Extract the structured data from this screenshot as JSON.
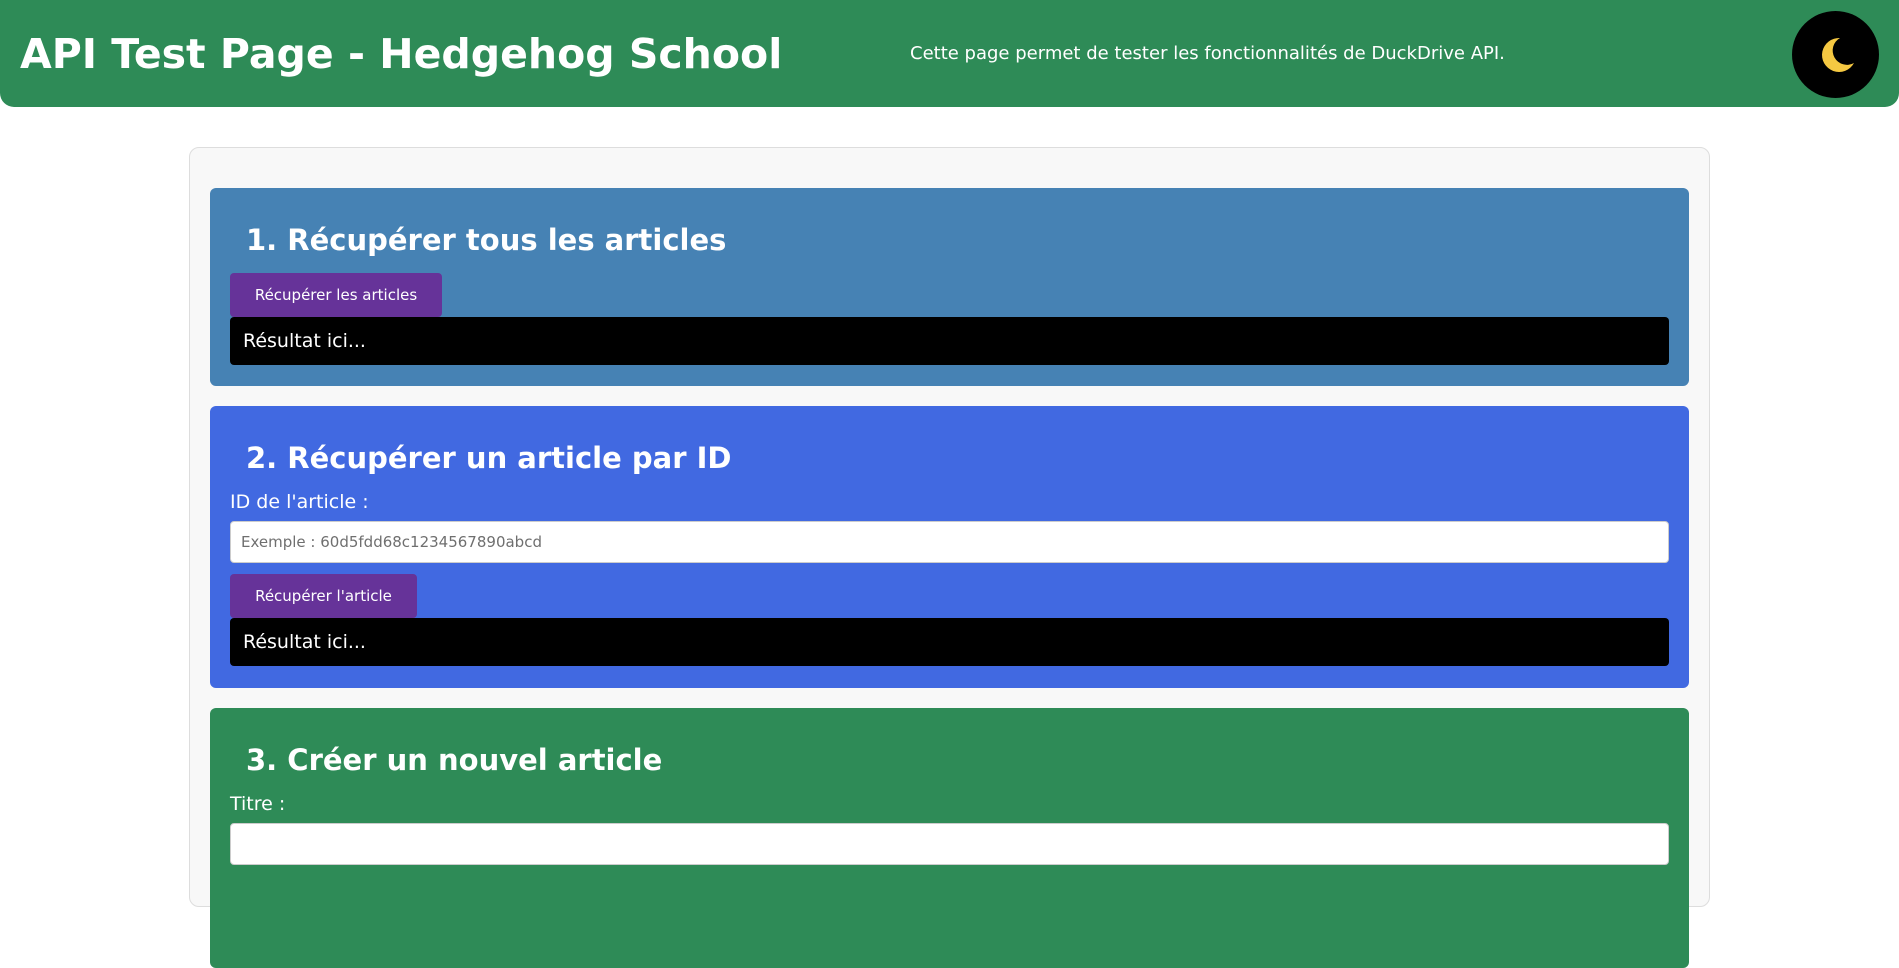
{
  "header": {
    "title": "API Test Page - Hedgehog School",
    "subtitle": "Cette page permet de tester les fonctionnalités de DuckDrive API.",
    "theme_toggle_icon": "moon-icon",
    "background_color": "#2e8b57"
  },
  "sections": [
    {
      "title": "1. Récupérer tous les articles",
      "button_label": "Récupérer les articles",
      "result_text": "Résultat ici...",
      "background_color": "#4682b4"
    },
    {
      "title": "2. Récupérer un article par ID",
      "field_label": "ID de l'article :",
      "input_placeholder": "Exemple : 60d5fdd68c1234567890abcd",
      "input_value": "",
      "button_label": "Récupérer l'article",
      "result_text": "Résultat ici...",
      "background_color": "#4169e1"
    },
    {
      "title": "3. Créer un nouvel article",
      "field_label": "Titre :",
      "input_value": "",
      "background_color": "#2e8b57"
    }
  ],
  "colors": {
    "button": "#663399",
    "result_background": "#000000",
    "moon": "#f5c842"
  }
}
